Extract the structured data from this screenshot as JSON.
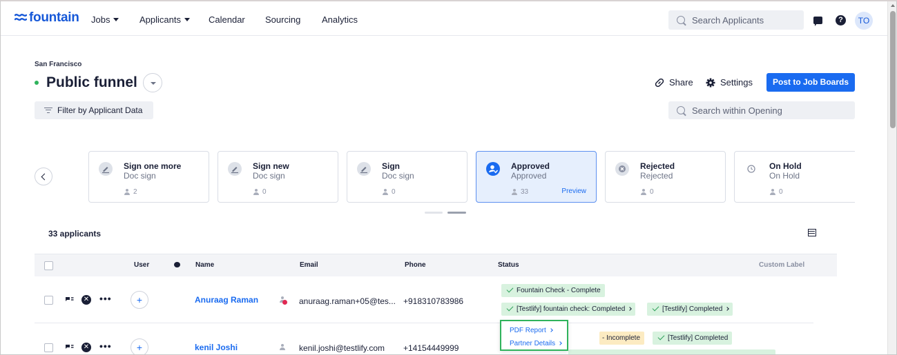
{
  "nav": {
    "logo": "fountain",
    "jobs": "Jobs",
    "applicants": "Applicants",
    "calendar": "Calendar",
    "sourcing": "Sourcing",
    "analytics": "Analytics",
    "search_placeholder": "Search Applicants",
    "avatar_initials": "TO"
  },
  "header": {
    "location": "San Francisco",
    "title": "Public funnel",
    "share": "Share",
    "settings": "Settings",
    "post": "Post to Job Boards",
    "filter": "Filter by Applicant Data",
    "search_placeholder": "Search within Opening"
  },
  "stages": [
    {
      "name": "Sign one more",
      "sub": "Doc sign",
      "count": "2",
      "icon": "signature-icon"
    },
    {
      "name": "Sign new",
      "sub": "Doc sign",
      "count": "0",
      "icon": "signature-icon"
    },
    {
      "name": "Sign",
      "sub": "Doc sign",
      "count": "0",
      "icon": "signature-icon"
    },
    {
      "name": "Approved",
      "sub": "Approved",
      "count": "33",
      "icon": "approved-user-icon",
      "preview": "Preview",
      "active": true
    },
    {
      "name": "Rejected",
      "sub": "Rejected",
      "count": "0",
      "icon": "reject-icon"
    },
    {
      "name": "On Hold",
      "sub": "On Hold",
      "count": "0",
      "icon": "clock-icon"
    }
  ],
  "list": {
    "count_label": "33 applicants",
    "columns": {
      "user": "User",
      "name": "Name",
      "email": "Email",
      "phone": "Phone",
      "status": "Status",
      "custom": "Custom Label"
    },
    "rows": [
      {
        "name": "Anuraag Raman",
        "email": "anuraag.raman+05@tes...",
        "phone": "+918310783986",
        "tags": [
          {
            "label": "Fountain Check - Complete",
            "color": "green"
          },
          {
            "label": "[Testlify] fountain check: Completed",
            "color": "green"
          },
          {
            "label": "[Testlify] Completed",
            "color": "green"
          }
        ]
      },
      {
        "name": "kenil Joshi",
        "email": "kenil.joshi@testlify.com",
        "phone": "+14154449999",
        "tags": [
          {
            "label": "- Incomplete",
            "color": "yellow"
          },
          {
            "label": "[Testlify] Completed",
            "color": "green"
          }
        ]
      }
    ]
  },
  "popup": {
    "pdf_report": "PDF Report",
    "partner_details": "Partner Details"
  },
  "colors": {
    "brand": "#1658d8",
    "primary_button": "#1a6bf0",
    "status_green": "#d8f2df",
    "status_yellow": "#fcebc2",
    "highlight_border": "#2fb35c"
  }
}
